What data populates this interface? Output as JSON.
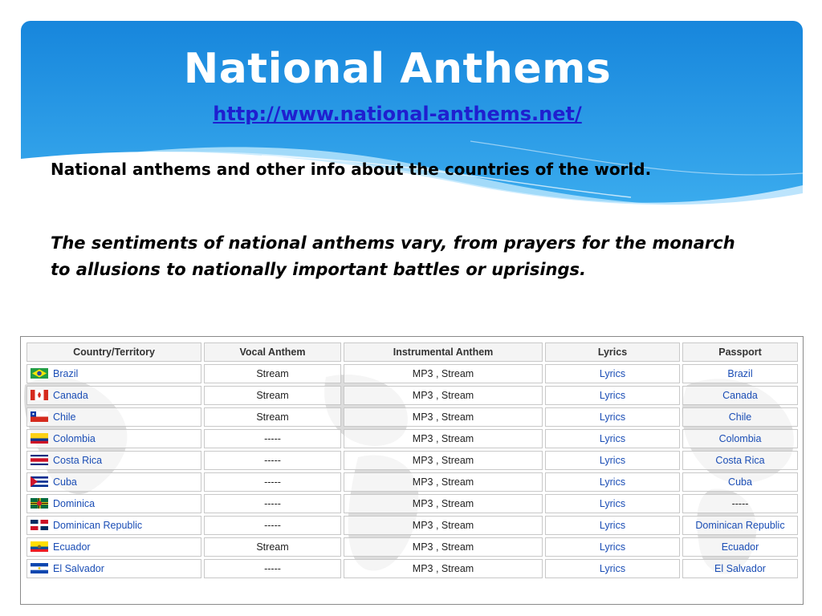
{
  "slide": {
    "title": "National Anthems",
    "url": "http://www.national-anthems.net/",
    "intro": "National anthems and other info about the countries of the world.",
    "quote": "The sentiments of national anthems vary, from prayers for the monarch to allusions to nationally important battles or uprisings."
  },
  "colors": {
    "header_blue": "#1e8fe0",
    "link_blue": "#1a4db5"
  },
  "table": {
    "headers": [
      "Country/Territory",
      "Vocal Anthem",
      "Instrumental Anthem",
      "Lyrics",
      "Passport"
    ],
    "rows": [
      {
        "country": "Brazil",
        "flag": "brazil-flag-icon",
        "vocal": "Stream",
        "instrumental": "MP3 , Stream",
        "lyrics": "Lyrics",
        "passport": "Brazil"
      },
      {
        "country": "Canada",
        "flag": "canada-flag-icon",
        "vocal": "Stream",
        "instrumental": "MP3 , Stream",
        "lyrics": "Lyrics",
        "passport": "Canada"
      },
      {
        "country": "Chile",
        "flag": "chile-flag-icon",
        "vocal": "Stream",
        "instrumental": "MP3 , Stream",
        "lyrics": "Lyrics",
        "passport": "Chile"
      },
      {
        "country": "Colombia",
        "flag": "colombia-flag-icon",
        "vocal": "-----",
        "instrumental": "MP3 , Stream",
        "lyrics": "Lyrics",
        "passport": "Colombia"
      },
      {
        "country": "Costa Rica",
        "flag": "costa-rica-flag-icon",
        "vocal": "-----",
        "instrumental": "MP3 , Stream",
        "lyrics": "Lyrics",
        "passport": "Costa Rica"
      },
      {
        "country": "Cuba",
        "flag": "cuba-flag-icon",
        "vocal": "-----",
        "instrumental": "MP3 , Stream",
        "lyrics": "Lyrics",
        "passport": "Cuba"
      },
      {
        "country": "Dominica",
        "flag": "dominica-flag-icon",
        "vocal": "-----",
        "instrumental": "MP3 , Stream",
        "lyrics": "Lyrics",
        "passport": "-----"
      },
      {
        "country": "Dominican Republic",
        "flag": "dominican-republic-flag-icon",
        "vocal": "-----",
        "instrumental": "MP3 , Stream",
        "lyrics": "Lyrics",
        "passport": "Dominican Republic"
      },
      {
        "country": "Ecuador",
        "flag": "ecuador-flag-icon",
        "vocal": "Stream",
        "instrumental": "MP3 , Stream",
        "lyrics": "Lyrics",
        "passport": "Ecuador"
      },
      {
        "country": "El Salvador",
        "flag": "el-salvador-flag-icon",
        "vocal": "-----",
        "instrumental": "MP3 , Stream",
        "lyrics": "Lyrics",
        "passport": "El Salvador"
      }
    ]
  }
}
